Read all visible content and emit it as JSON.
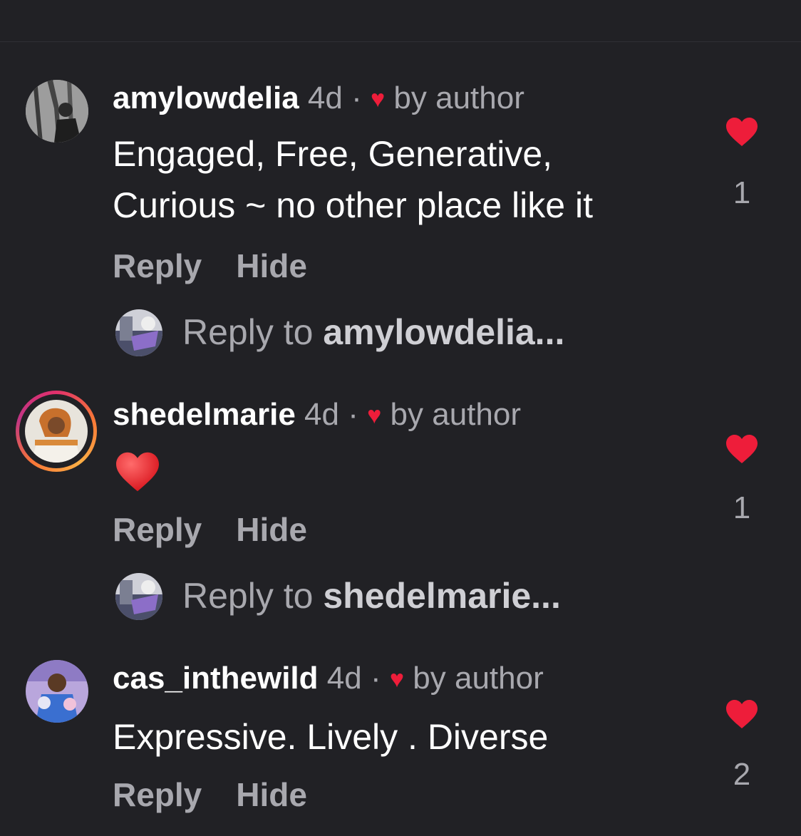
{
  "comments": [
    {
      "username": "amylowdelia",
      "time": "4d",
      "separator": "·",
      "liked_by": "by author",
      "text_lines": [
        "Engaged, Free, Generative,",
        "Curious ~ no other place like it"
      ],
      "reply_label": "Reply",
      "hide_label": "Hide",
      "like_count": "1",
      "reply_prefix": "Reply to",
      "reply_target": "amylowdelia..."
    },
    {
      "username": "shedelmarie",
      "time": "4d",
      "separator": "·",
      "liked_by": "by author",
      "text": "❤️",
      "reply_label": "Reply",
      "hide_label": "Hide",
      "like_count": "1",
      "reply_prefix": "Reply to",
      "reply_target": "shedelmarie..."
    },
    {
      "username": "cas_inthewild",
      "time": "4d",
      "separator": "·",
      "liked_by": "by author",
      "text": "Expressive. Lively . Diverse",
      "reply_label": "Reply",
      "hide_label": "Hide",
      "like_count": "2"
    }
  ],
  "colors": {
    "background": "#212125",
    "like_red": "#ee1d3a",
    "muted_text": "#a8a8ae",
    "primary_text": "#ffffff"
  },
  "icons": {
    "author_like": "small-heart-icon",
    "like_button": "heart-icon",
    "emoji": "red-heart-emoji"
  }
}
